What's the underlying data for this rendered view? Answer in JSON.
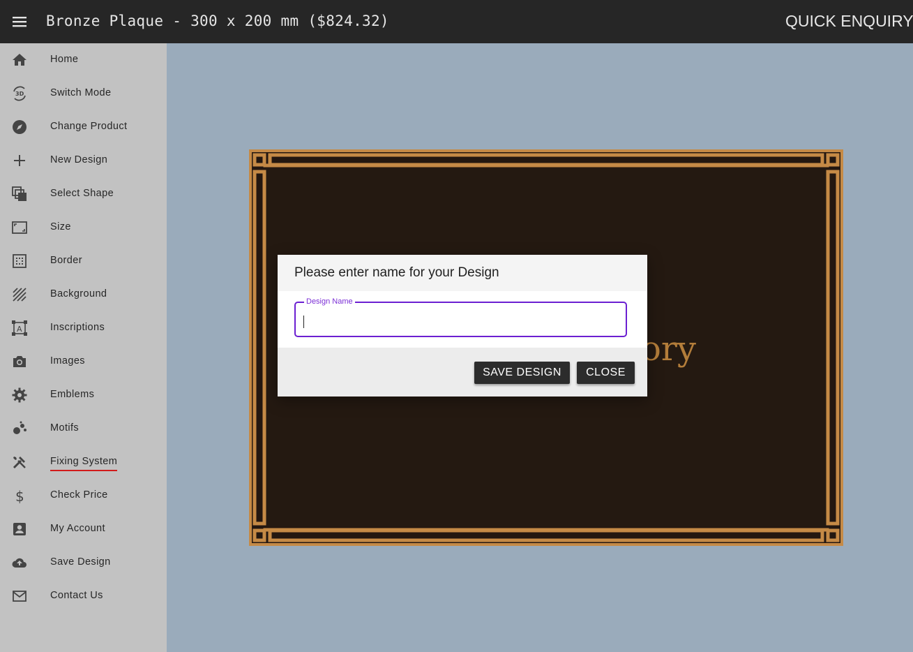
{
  "app": {
    "title": "Bronze Plaque - 300 x 200 mm ($824.32)",
    "quick_enquiry": "QUICK ENQUIRY"
  },
  "sidebar": {
    "items": [
      {
        "label": "Home",
        "icon": "home-icon"
      },
      {
        "label": "Switch Mode",
        "icon": "3d-rotation-icon"
      },
      {
        "label": "Change Product",
        "icon": "compass-icon"
      },
      {
        "label": "New Design",
        "icon": "plus-icon"
      },
      {
        "label": "Select Shape",
        "icon": "layers-icon"
      },
      {
        "label": "Size",
        "icon": "aspect-ratio-icon"
      },
      {
        "label": "Border",
        "icon": "border-icon"
      },
      {
        "label": "Background",
        "icon": "texture-icon"
      },
      {
        "label": "Inscriptions",
        "icon": "text-box-icon"
      },
      {
        "label": "Images",
        "icon": "camera-icon"
      },
      {
        "label": "Emblems",
        "icon": "gear-icon"
      },
      {
        "label": "Motifs",
        "icon": "motif-icon"
      },
      {
        "label": "Fixing System",
        "icon": "tools-icon",
        "active": true
      },
      {
        "label": "Check Price",
        "icon": "dollar-icon"
      },
      {
        "label": "My Account",
        "icon": "account-box-icon"
      },
      {
        "label": "Save Design",
        "icon": "cloud-upload-icon"
      },
      {
        "label": "Contact Us",
        "icon": "mail-icon"
      }
    ]
  },
  "canvas": {
    "inscription_visible_fragment": "ory",
    "colors": {
      "bronze": "#c58a46",
      "plaque": "#231710",
      "background": "#9aabbb"
    }
  },
  "dialog": {
    "title": "Please enter name for your Design",
    "field_label": "Design Name",
    "field_value": "",
    "save_label": "SAVE DESIGN",
    "close_label": "CLOSE",
    "accent": "#6b1fd1"
  }
}
